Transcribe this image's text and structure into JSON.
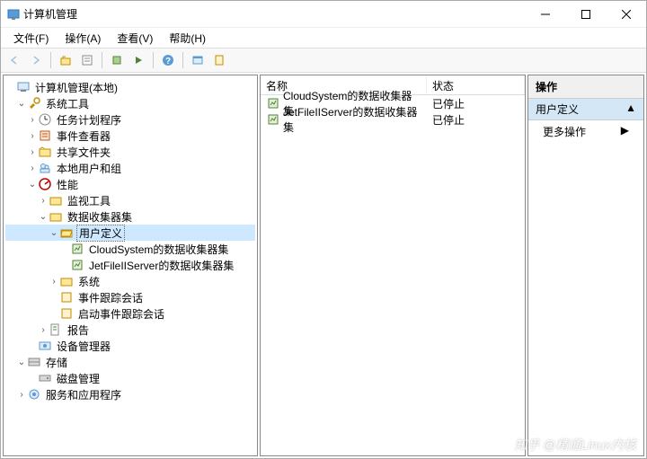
{
  "window": {
    "title": "计算机管理"
  },
  "menu": {
    "file": "文件(F)",
    "action": "操作(A)",
    "view": "查看(V)",
    "help": "帮助(H)"
  },
  "tree": {
    "root": "计算机管理(本地)",
    "systools": "系统工具",
    "scheduler": "任务计划程序",
    "eventviewer": "事件查看器",
    "sharedfolders": "共享文件夹",
    "localusers": "本地用户和组",
    "performance": "性能",
    "monitortools": "监视工具",
    "dcs": "数据收集器集",
    "userdefined": "用户定义",
    "dcs_cloud": "CloudSystem的数据收集器集",
    "dcs_jetfile": "JetFileIIServer的数据收集器集",
    "system": "系统",
    "eventtrace": "事件跟踪会话",
    "startupevent": "启动事件跟踪会话",
    "reports": "报告",
    "devmgr": "设备管理器",
    "storage": "存储",
    "diskmgr": "磁盘管理",
    "services": "服务和应用程序"
  },
  "list": {
    "col_name": "名称",
    "col_status": "状态",
    "rows": [
      {
        "name": "CloudSystem的数据收集器集",
        "status": "已停止"
      },
      {
        "name": "JetFileIIServer的数据收集器集",
        "status": "已停止"
      }
    ]
  },
  "actions": {
    "header": "操作",
    "context": "用户定义",
    "more": "更多操作"
  },
  "watermark": "知乎 @精通Linux内核"
}
